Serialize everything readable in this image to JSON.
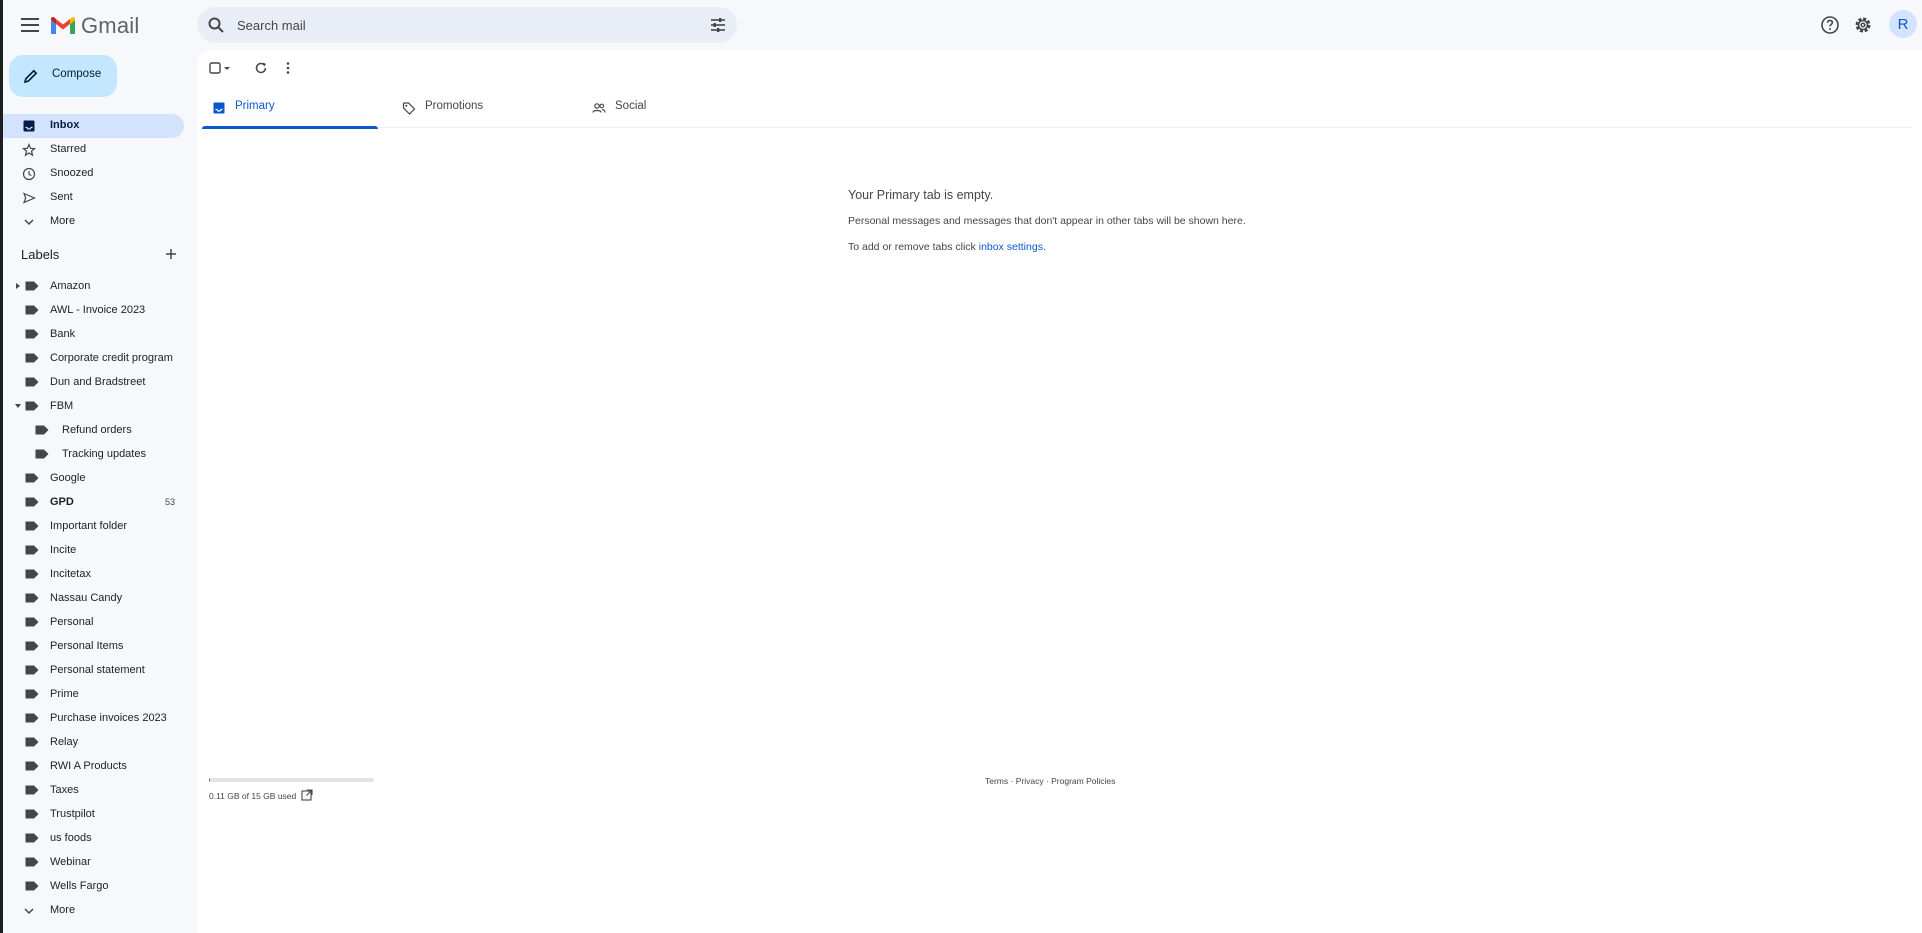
{
  "header": {
    "app_name": "Gmail",
    "search_placeholder": "Search mail",
    "avatar_initial": "R"
  },
  "compose": {
    "label": "Compose"
  },
  "nav": [
    {
      "label": "Inbox",
      "icon": "inbox-icon",
      "active": true
    },
    {
      "label": "Starred",
      "icon": "star-icon"
    },
    {
      "label": "Snoozed",
      "icon": "clock-icon"
    },
    {
      "label": "Sent",
      "icon": "send-icon"
    },
    {
      "label": "More",
      "icon": "chevron-down-icon"
    }
  ],
  "labels": {
    "title": "Labels",
    "items": [
      {
        "label": "Amazon",
        "expandable": "collapsed"
      },
      {
        "label": "AWL - Invoice 2023"
      },
      {
        "label": "Bank"
      },
      {
        "label": "Corporate credit program"
      },
      {
        "label": "Dun and Bradstreet"
      },
      {
        "label": "FBM",
        "expandable": "expanded"
      },
      {
        "label": "Refund orders",
        "child": true
      },
      {
        "label": "Tracking updates",
        "child": true
      },
      {
        "label": "Google"
      },
      {
        "label": "GPD",
        "bold": true,
        "count": "53"
      },
      {
        "label": "Important folder"
      },
      {
        "label": "Incite"
      },
      {
        "label": "Incitetax"
      },
      {
        "label": "Nassau Candy"
      },
      {
        "label": "Personal"
      },
      {
        "label": "Personal Items"
      },
      {
        "label": "Personal statement"
      },
      {
        "label": "Prime"
      },
      {
        "label": "Purchase invoices 2023"
      },
      {
        "label": "Relay"
      },
      {
        "label": "RWI A Products"
      },
      {
        "label": "Taxes"
      },
      {
        "label": "Trustpilot"
      },
      {
        "label": "us foods"
      },
      {
        "label": "Webinar"
      },
      {
        "label": "Wells Fargo"
      }
    ],
    "more_label": "More"
  },
  "tabs": [
    {
      "label": "Primary",
      "icon": "inbox-tab-icon",
      "active": true
    },
    {
      "label": "Promotions",
      "icon": "tag-icon"
    },
    {
      "label": "Social",
      "icon": "people-icon"
    }
  ],
  "empty": {
    "title": "Your Primary tab is empty.",
    "subtitle": "Personal messages and messages that don't appear in other tabs will be shown here.",
    "hint_prefix": "To add or remove tabs click ",
    "hint_link": "inbox settings",
    "hint_suffix": "."
  },
  "footer": {
    "storage_text": "0.11 GB of 15 GB used",
    "storage_fraction": 0.007,
    "terms": "Terms",
    "privacy": "Privacy",
    "policies": "Program Policies",
    "separator": " · "
  },
  "colors": {
    "accent": "#0b57d0",
    "compose_bg": "#c2e7ff",
    "active_nav_bg": "#d3e3fd"
  }
}
